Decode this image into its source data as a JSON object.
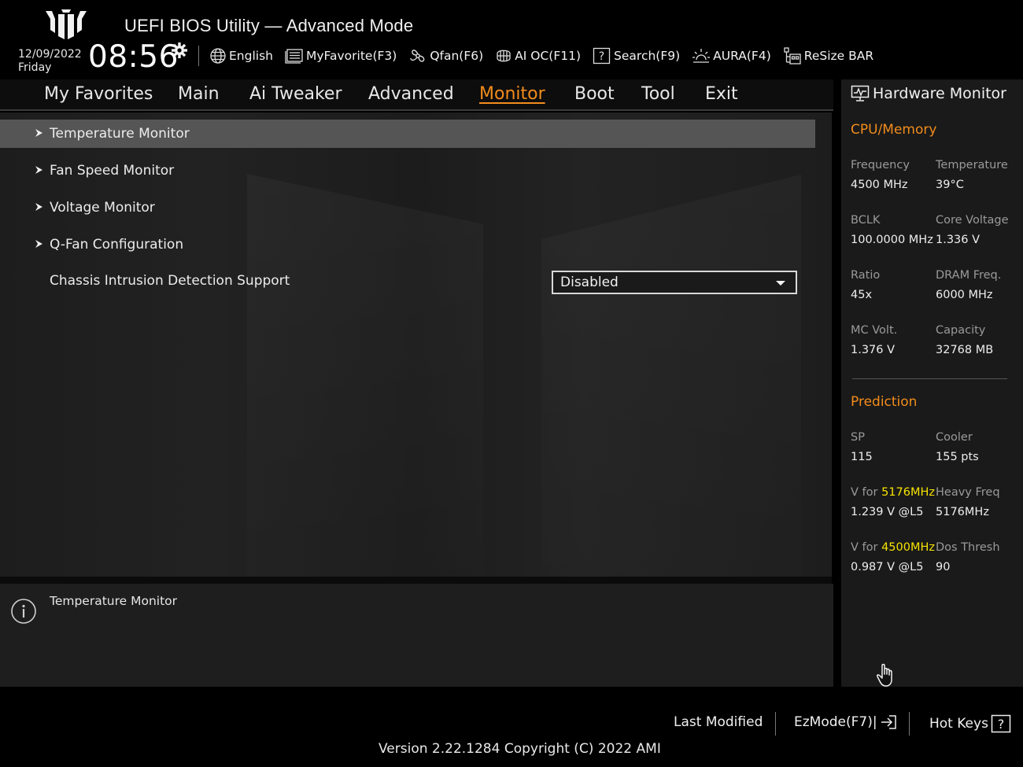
{
  "header": {
    "title": "UEFI BIOS Utility — Advanced Mode",
    "date": "12/09/2022",
    "weekday": "Friday",
    "time": "08:56",
    "toolbar": [
      {
        "icon": "globe-icon",
        "label": "English"
      },
      {
        "icon": "favorite-list-icon",
        "label": "MyFavorite(F3)"
      },
      {
        "icon": "fan-icon",
        "label": "Qfan(F6)"
      },
      {
        "icon": "ai-oc-icon",
        "label": "AI OC(F11)"
      },
      {
        "icon": "search-help-icon",
        "label": "Search(F9)"
      },
      {
        "icon": "aura-icon",
        "label": "AURA(F4)"
      },
      {
        "icon": "resize-bar-icon",
        "label": "ReSize BAR"
      }
    ]
  },
  "nav": {
    "tabs": [
      "My Favorites",
      "Main",
      "Ai Tweaker",
      "Advanced",
      "Monitor",
      "Boot",
      "Tool",
      "Exit"
    ],
    "active": "Monitor"
  },
  "main": {
    "items": [
      {
        "label": "Temperature Monitor",
        "submenu": true,
        "selected": true
      },
      {
        "label": "Fan Speed Monitor",
        "submenu": true
      },
      {
        "label": "Voltage Monitor",
        "submenu": true
      },
      {
        "label": "Q-Fan Configuration",
        "submenu": true
      },
      {
        "label": "Chassis Intrusion Detection Support",
        "submenu": false
      }
    ],
    "chassis_value": "Disabled"
  },
  "help": {
    "text": "Temperature Monitor"
  },
  "hardware_monitor": {
    "title": "Hardware Monitor",
    "cpu_memory": {
      "heading": "CPU/Memory",
      "frequency_label": "Frequency",
      "frequency": "4500 MHz",
      "temperature_label": "Temperature",
      "temperature": "39°C",
      "bclk_label": "BCLK",
      "bclk": "100.0000 MHz",
      "core_voltage_label": "Core Voltage",
      "core_voltage": "1.336 V",
      "ratio_label": "Ratio",
      "ratio": "45x",
      "dram_freq_label": "DRAM Freq.",
      "dram_freq": "6000 MHz",
      "mc_volt_label": "MC Volt.",
      "mc_volt": "1.376 V",
      "capacity_label": "Capacity",
      "capacity": "32768 MB"
    },
    "prediction": {
      "heading": "Prediction",
      "sp_label": "SP",
      "sp": "115",
      "cooler_label": "Cooler",
      "cooler": "155 pts",
      "v_for_prefix": "V for",
      "v_for_1_freq": "5176MHz",
      "v_for_1": "1.239 V @L5",
      "heavy_freq_label": "Heavy Freq",
      "heavy_freq": "5176MHz",
      "v_for_2_freq": "4500MHz",
      "v_for_2": "0.987 V @L5",
      "dos_thresh_label": "Dos Thresh",
      "dos_thresh": "90"
    }
  },
  "footer": {
    "last_modified": "Last Modified",
    "ezmode": "EzMode(F7)|",
    "hot_keys": "Hot Keys",
    "version": "Version 2.22.1284 Copyright (C) 2022 AMI"
  },
  "colors": {
    "accent": "#f28c1c",
    "highlight": "#f5e300",
    "selected_row": "#555555"
  }
}
